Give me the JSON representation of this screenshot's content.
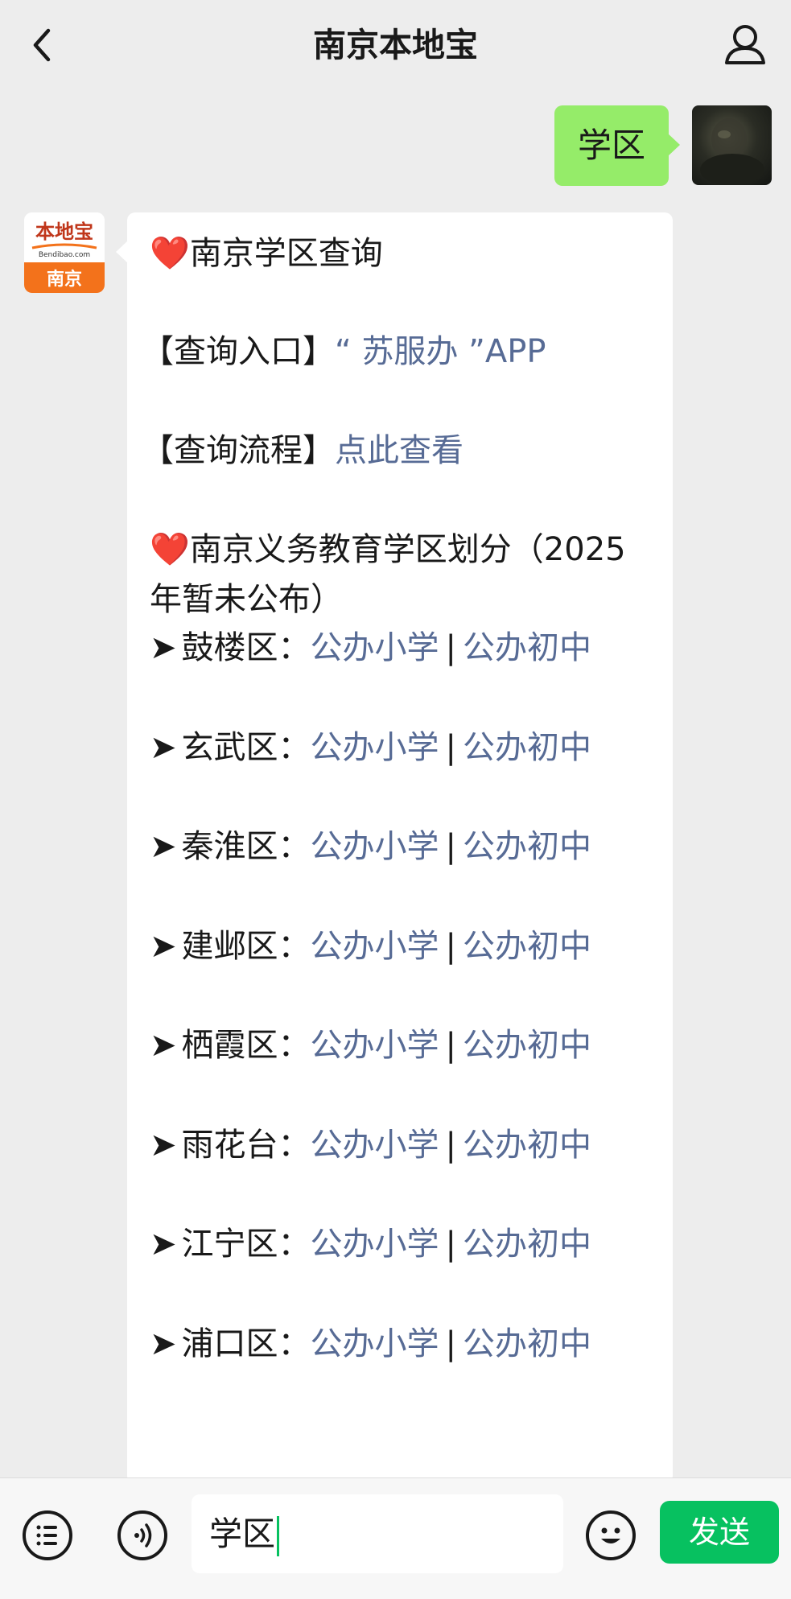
{
  "header": {
    "title": "南京本地宝"
  },
  "outgoing_message": {
    "text": "学区"
  },
  "incoming_avatar": {
    "top_text": "本地宝",
    "domain_text": "Bendibao.com",
    "city_text": "南京",
    "brand_color": "#f3721b"
  },
  "incoming_message": {
    "heading1": "南京学区查询",
    "entry_label": "【查询入口】",
    "entry_link": "“ 苏服办 ”APP",
    "flow_label": "【查询流程】",
    "flow_link": "点此查看",
    "heading2": "南京义务教育学区划分（2025年暂未公布）",
    "arrow": "➤",
    "separator": "|",
    "districts": [
      {
        "name": "鼓楼区：",
        "primary": "公办小学",
        "junior": "公办初中"
      },
      {
        "name": "玄武区：",
        "primary": "公办小学",
        "junior": "公办初中"
      },
      {
        "name": "秦淮区：",
        "primary": "公办小学",
        "junior": "公办初中"
      },
      {
        "name": "建邺区：",
        "primary": "公办小学",
        "junior": "公办初中"
      },
      {
        "name": "栖霞区：",
        "primary": "公办小学",
        "junior": "公办初中"
      },
      {
        "name": "雨花台：",
        "primary": "公办小学",
        "junior": "公办初中"
      },
      {
        "name": "江宁区：",
        "primary": "公办小学",
        "junior": "公办初中"
      },
      {
        "name": "浦口区：",
        "primary": "公办小学",
        "junior": "公办初中"
      }
    ]
  },
  "input_bar": {
    "input_value": "学区",
    "send_label": "发送"
  },
  "colors": {
    "link": "#576b95",
    "send_green": "#07c160",
    "bubble_green": "#95ec69",
    "heart_red": "#e21d2d"
  }
}
